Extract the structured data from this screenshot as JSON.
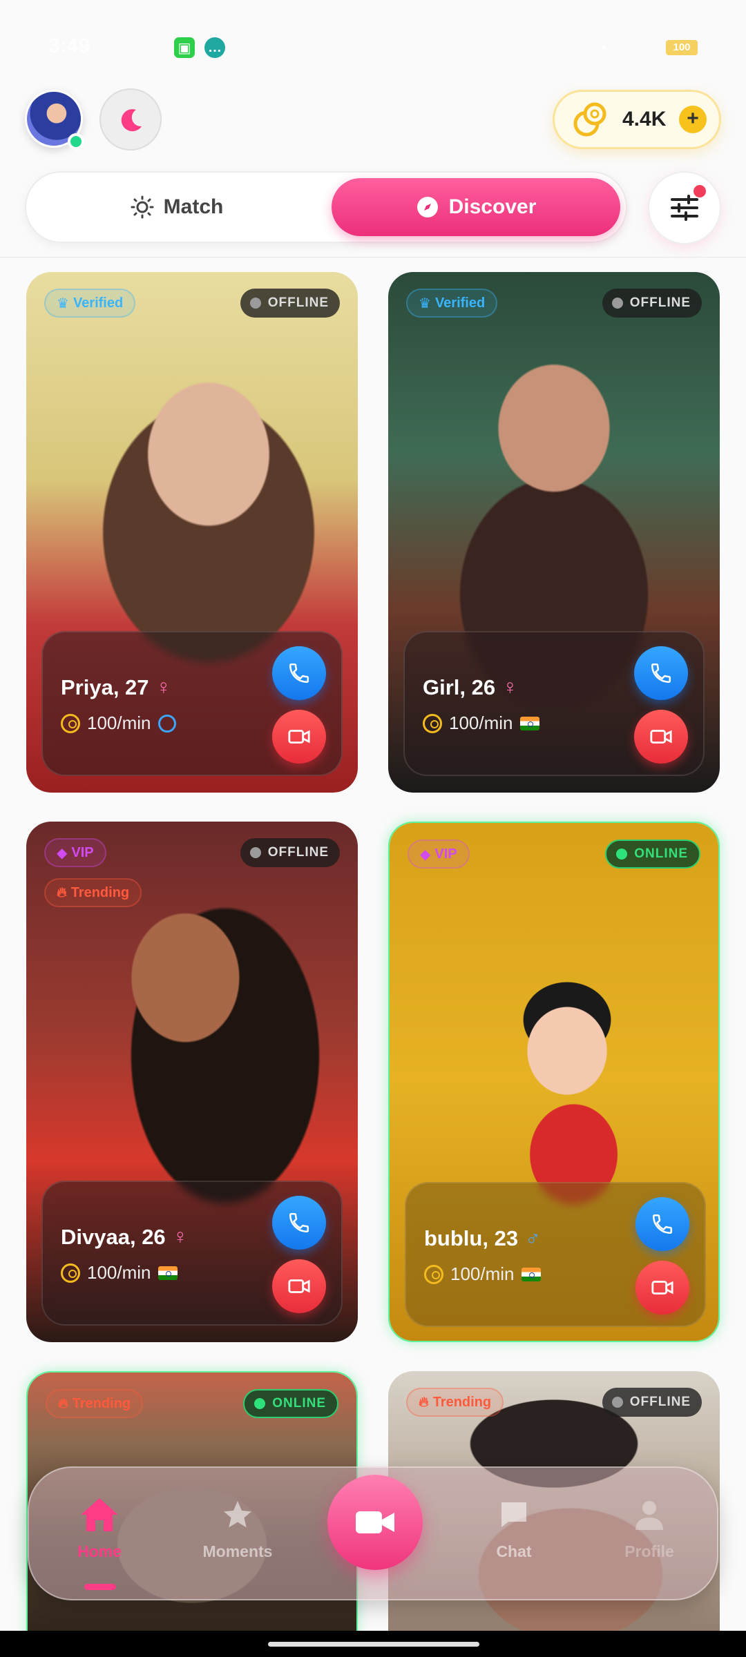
{
  "status_bar": {
    "time": "3:49",
    "battery": "100"
  },
  "header": {
    "coins_label": "4.4K",
    "coins_add": "+"
  },
  "tabs": [
    {
      "label": "Match"
    },
    {
      "label": "Discover"
    }
  ],
  "cards": [
    {
      "name": "Priya, 27",
      "gender": "♀",
      "rate": "100/min",
      "status": "OFFLINE",
      "badges": [
        "Verified"
      ],
      "country": "globe"
    },
    {
      "name": "Girl, 26",
      "gender": "♀",
      "rate": "100/min",
      "status": "OFFLINE",
      "badges": [
        "Verified"
      ],
      "country": "india-flag"
    },
    {
      "name": "Divyaa, 26",
      "gender": "♀",
      "rate": "100/min",
      "status": "OFFLINE",
      "badges": [
        "VIP",
        "Trending"
      ],
      "country": "india-flag"
    },
    {
      "name": "bublu, 23",
      "gender": "♂",
      "rate": "100/min",
      "status": "ONLINE",
      "badges": [
        "VIP"
      ],
      "country": "india-flag"
    },
    {
      "name": "",
      "status": "ONLINE",
      "badges": [
        "Trending"
      ]
    },
    {
      "name": "",
      "status": "OFFLINE",
      "badges": [
        "Trending"
      ]
    }
  ],
  "bottom_nav": [
    {
      "label": "Home",
      "active": true
    },
    {
      "label": "Moments"
    },
    {
      "label": "Chat"
    },
    {
      "label": "Profile"
    }
  ],
  "colors": {
    "accent": "#ec2f7a",
    "call": "#1478ee",
    "video": "#e82d3a",
    "online": "#2de27a",
    "coin": "#f8c21c"
  }
}
